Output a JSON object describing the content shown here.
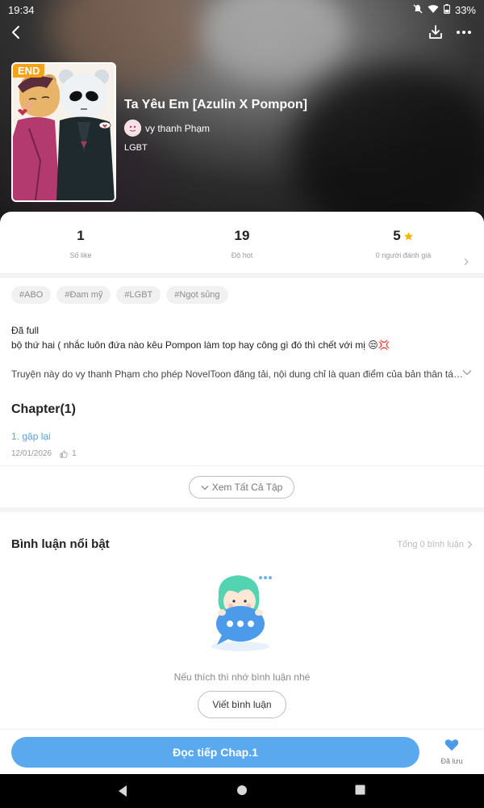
{
  "status_bar": {
    "time": "19:34",
    "battery": "33%"
  },
  "book": {
    "end_badge": "END",
    "title": "Ta Yêu Em [Azulin X Pompon]",
    "author": "vy thanh Phạm",
    "genre": "LGBT"
  },
  "stats": [
    {
      "value": "1",
      "label": "Số like"
    },
    {
      "value": "19",
      "label": "Độ hot"
    },
    {
      "value": "5",
      "label": "0 người đánh giá"
    }
  ],
  "tags": [
    "#ABO",
    "#Đam mỹ",
    "#LGBT",
    "#Ngọt sủng"
  ],
  "description": {
    "line1": "Đã full",
    "line2": "bộ thứ hai ( nhắc luôn đứa nào kêu Pompon làm top hay công gì đó thì chết với mị 😒💢"
  },
  "notice": "Truyện này do vy thanh Phạm cho phép NovelToon đăng tải, nội dung chỉ là quan điểm của bản thân tác giả",
  "chapters": {
    "heading": "Chapter(1)",
    "items": [
      {
        "title": "1. gặp lại",
        "date": "12/01/2026",
        "likes": "1"
      }
    ],
    "view_all": "Xem Tất Cả Tập"
  },
  "comments": {
    "heading": "Bình luận nổi bật",
    "total": "Tổng 0 bình luận",
    "empty_text": "Nếu thích thì nhớ bình luận nhé",
    "write_button": "Viết bình luận"
  },
  "bottom": {
    "read_button": "Đọc tiếp Chap.1",
    "saved_label": "Đã lưu"
  },
  "colors": {
    "accent": "#5aa9ef",
    "link": "#5a9fe0",
    "end_badge": "#f4a21a",
    "star": "#f7b500"
  }
}
